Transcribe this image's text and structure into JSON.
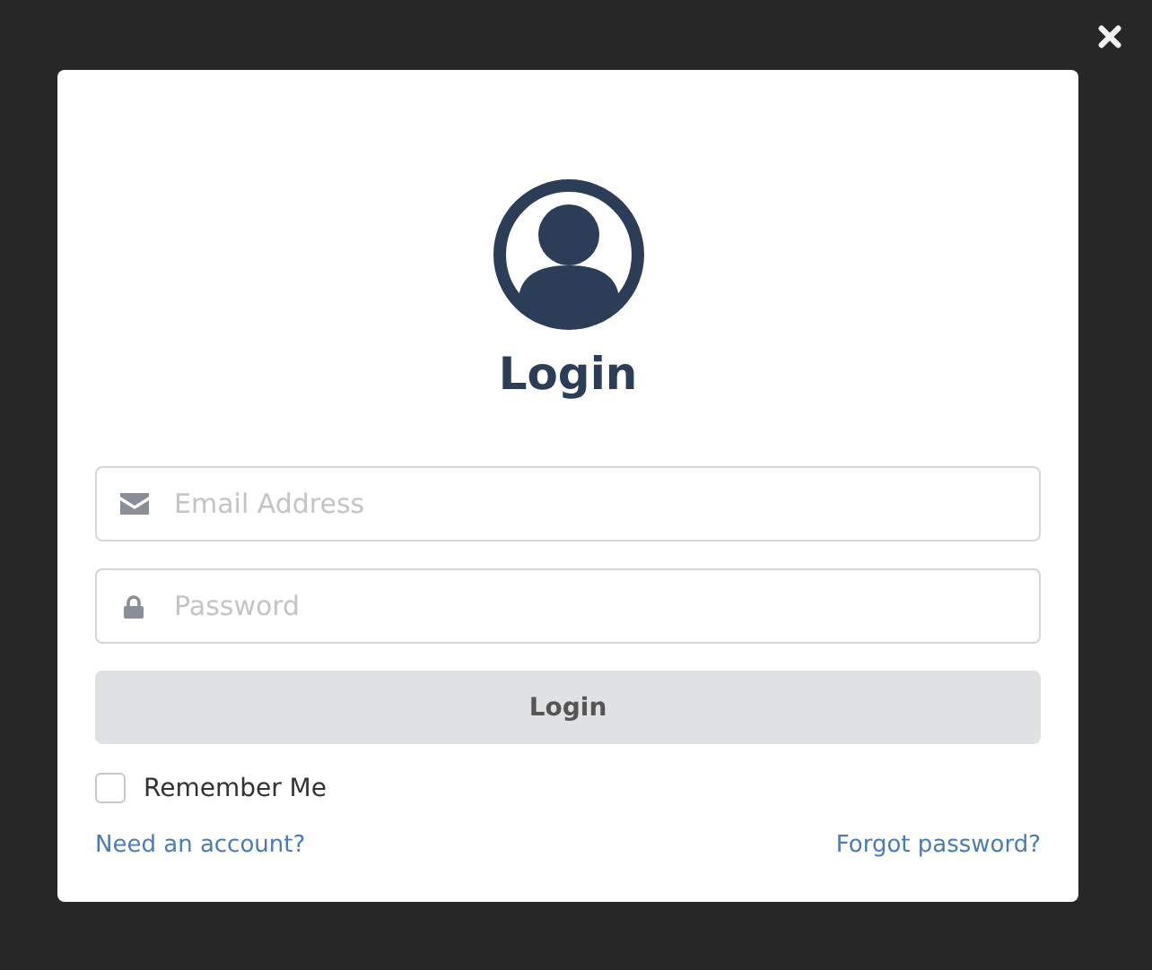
{
  "dialog": {
    "title": "Login",
    "fields": [
      {
        "kind": "email",
        "placeholder": "Email Address"
      },
      {
        "kind": "password",
        "placeholder": "Password"
      }
    ],
    "submit": "Login",
    "remember": {
      "label": "Remember Me",
      "checked": false
    },
    "links": [
      "Need an account?",
      "Forgot password?"
    ]
  }
}
